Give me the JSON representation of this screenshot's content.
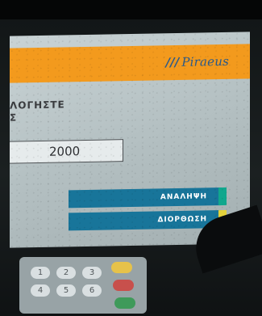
{
  "brand": {
    "mark": "///",
    "name": "Piraeus"
  },
  "prompt": {
    "line1": "ΛΟΓΗΣΤΕ",
    "line2": "Σ"
  },
  "amount": {
    "value": "2000"
  },
  "buttons": {
    "withdraw": "ΑΝΑΛΗΨΗ",
    "correct": "ΔΙΟΡΘΩΣΗ"
  },
  "keypad": {
    "keys": [
      "1",
      "2",
      "3",
      "4",
      "5",
      "6"
    ]
  },
  "colors": {
    "brand_orange": "#f39a1d",
    "button_blue": "#18759a",
    "accent_green": "#10a78d",
    "accent_yellow": "#e4d23b"
  }
}
